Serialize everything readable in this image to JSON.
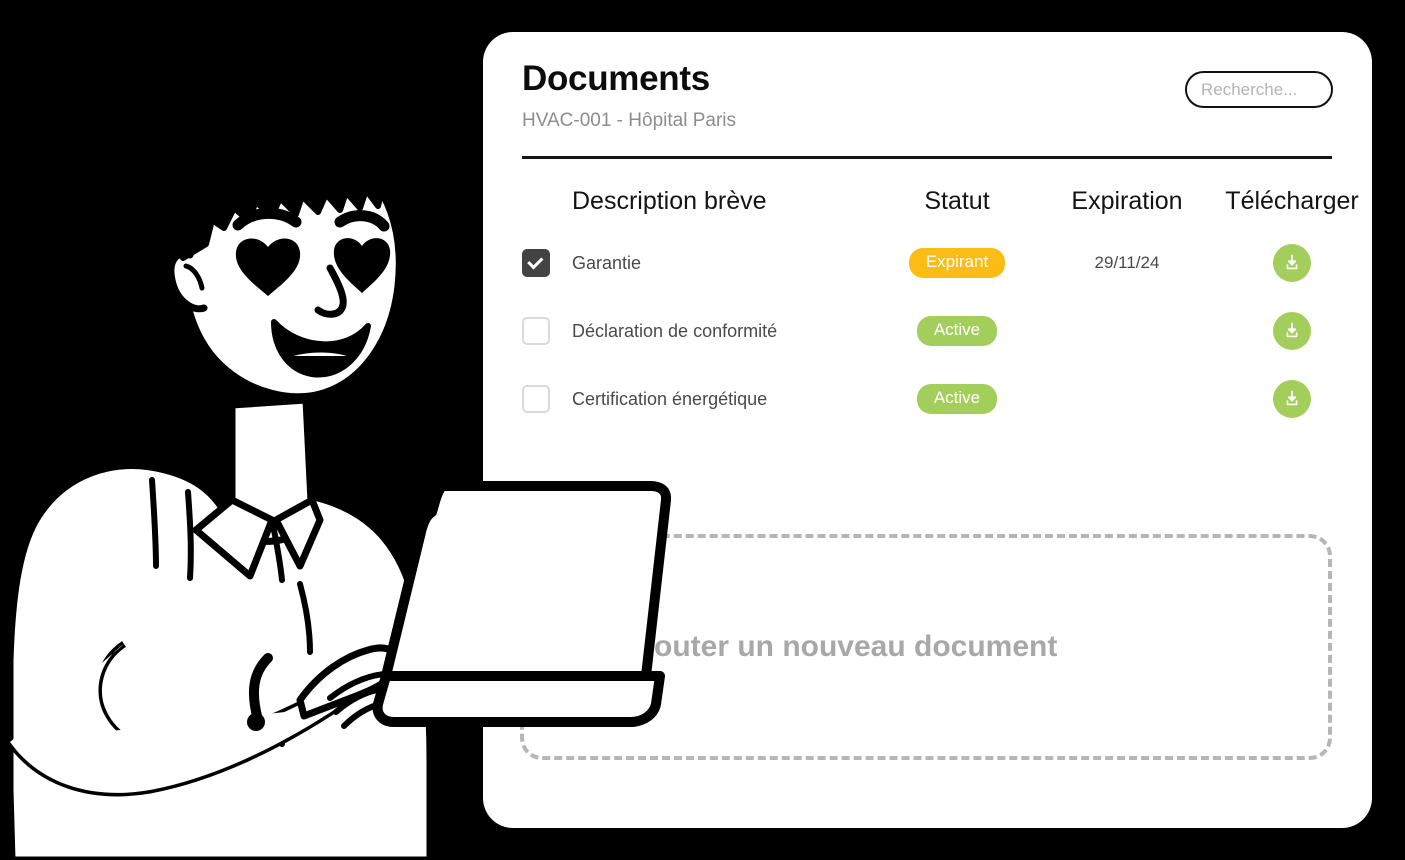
{
  "card": {
    "title": "Documents",
    "subtitle": "HVAC-001 - Hôpital Paris",
    "search": {
      "placeholder": "Recherche...",
      "value": ""
    }
  },
  "table": {
    "columns": [
      {
        "key": "select",
        "label": ""
      },
      {
        "key": "description",
        "label": "Description brève"
      },
      {
        "key": "statut",
        "label": "Statut"
      },
      {
        "key": "expiration",
        "label": "Expiration"
      },
      {
        "key": "telecharger",
        "label": "Télécharger"
      }
    ],
    "rows": [
      {
        "selected": true,
        "description": "Garantie",
        "status": "Expirant",
        "status_color": "#FBBC16",
        "expiration": "29/11/24",
        "download_icon": "download-icon",
        "download_color": "#A4CE5B"
      },
      {
        "selected": false,
        "description": "Déclaration de conformité",
        "status": "Active",
        "status_color": "#A4CE5B",
        "expiration": "",
        "download_icon": "download-icon",
        "download_color": "#A4CE5B"
      },
      {
        "selected": false,
        "description": "Certification énergétique",
        "status": "Active",
        "status_color": "#A4CE5B",
        "expiration": "",
        "download_icon": "download-icon",
        "download_color": "#A4CE5B"
      }
    ]
  },
  "dropzone": {
    "label": "Ajouter un nouveau document"
  },
  "illustration": {
    "name": "person-with-laptop-heart-eyes-illustration"
  },
  "colors": {
    "background": "#000000",
    "card": "#FFFFFF",
    "accent_green": "#A4CE5B",
    "accent_amber": "#FBBC16",
    "muted_text": "#8D8D8D",
    "dashed_border": "#B6B6B6"
  }
}
